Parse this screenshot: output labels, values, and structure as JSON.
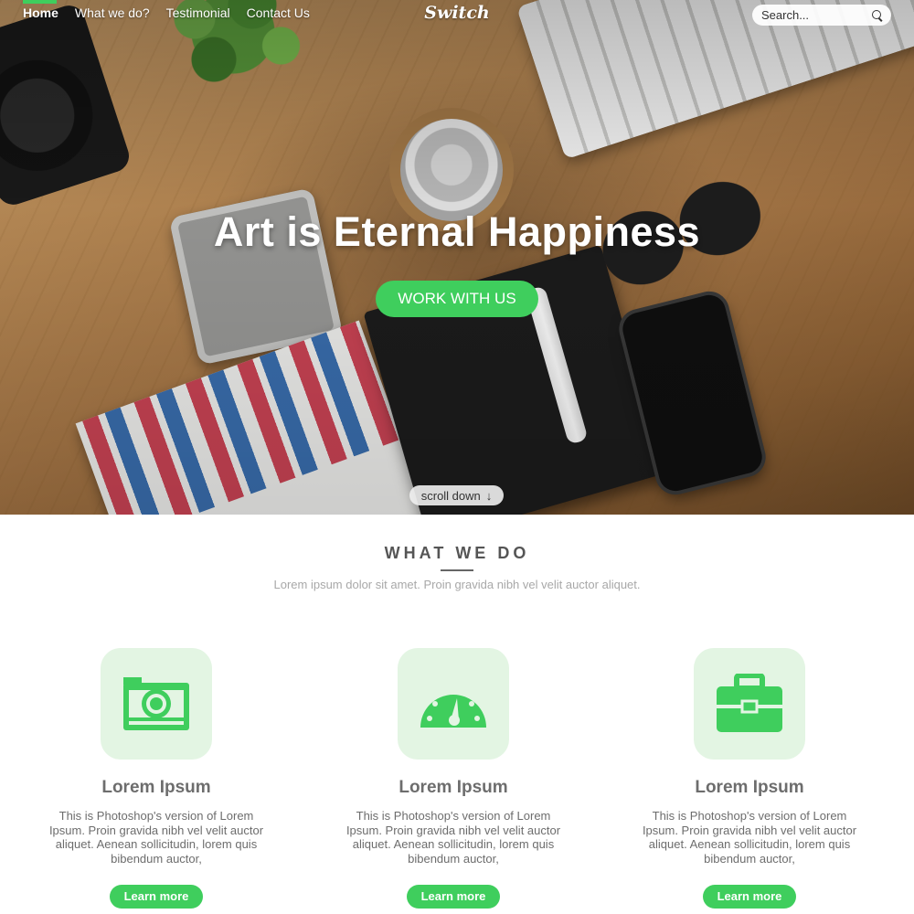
{
  "nav": {
    "items": [
      {
        "label": "Home",
        "active": true
      },
      {
        "label": "What we do?",
        "active": false
      },
      {
        "label": "Testimonial",
        "active": false
      },
      {
        "label": "Contact Us",
        "active": false
      }
    ],
    "logo": "Switch",
    "search_placeholder": "Search..."
  },
  "hero": {
    "title": "Art is Eternal Happiness",
    "cta_label": "WORK WITH US",
    "scroll_label": "scroll down",
    "scroll_arrow": "↓"
  },
  "section": {
    "title": "WHAT WE DO",
    "subtitle": "Lorem ipsum dolor sit amet. Proin gravida nibh vel velit auctor aliquet."
  },
  "features": [
    {
      "icon": "camera-icon",
      "title": "Lorem Ipsum",
      "text": "This is Photoshop's version  of Lorem Ipsum. Proin gravida nibh vel velit auctor aliquet. Aenean sollicitudin, lorem quis bibendum auctor,",
      "button": "Learn more"
    },
    {
      "icon": "dashboard-icon",
      "title": "Lorem Ipsum",
      "text": "This is Photoshop's version  of Lorem Ipsum. Proin gravida nibh vel velit auctor aliquet. Aenean sollicitudin, lorem quis bibendum auctor,",
      "button": "Learn more"
    },
    {
      "icon": "briefcase-icon",
      "title": "Lorem Ipsum",
      "text": "This is Photoshop's version  of Lorem Ipsum. Proin gravida nibh vel velit auctor aliquet. Aenean sollicitudin, lorem quis bibendum auctor,",
      "button": "Learn more"
    }
  ],
  "colors": {
    "accent": "#3fce5d",
    "icon_tile": "#e3f5e3",
    "body_text": "#6d6d6d"
  }
}
